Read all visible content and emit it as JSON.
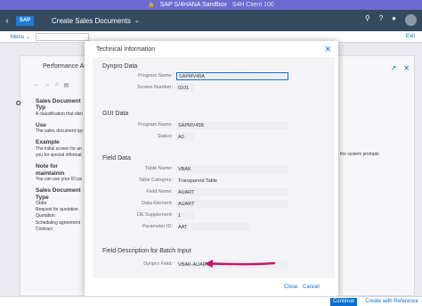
{
  "system_bar": {
    "title": "SAP S/4HANA Sandbox",
    "client": "S4H Client 100"
  },
  "shell": {
    "app_title": "Create Sales Documents",
    "logo": "SAP"
  },
  "menubar": {
    "menu": "Menu",
    "exit": "Exit"
  },
  "background": {
    "perf_title": "Performance As",
    "o_letter": "O",
    "help_lines": [
      {
        "t": "Sales Document Typ",
        "h": true
      },
      {
        "t": "A classification that disti",
        "h": false
      },
      {
        "t": "Use",
        "h": true
      },
      {
        "t": "The sales document typ",
        "h": false
      },
      {
        "t": "Example",
        "h": true
      },
      {
        "t": "The initial screen for an",
        "h": false
      },
      {
        "t": "you for special informat",
        "h": false
      },
      {
        "t": "Note for maintainin",
        "h": true
      },
      {
        "t": "You can use your ID pa",
        "h": false
      },
      {
        "t": "Sales Document Type",
        "h": true
      },
      {
        "t": "Order",
        "h": false
      },
      {
        "t": "Request for quotation",
        "h": false
      },
      {
        "t": "Quotation",
        "h": false
      },
      {
        "t": "Scheduling agreement",
        "h": false
      },
      {
        "t": "Contract",
        "h": false
      }
    ],
    "right_text": "the system prompts"
  },
  "dialog": {
    "title": "Technical Information",
    "sections": {
      "dynpro": {
        "heading": "Dynpro Data",
        "program_name_label": "Program Name:",
        "program_name": "SAPMV45A",
        "screen_number_label": "Screen Number:",
        "screen_number": "0101"
      },
      "gui": {
        "heading": "GUI Data",
        "program_name_label": "Program Name:",
        "program_name": "SAPMV45B",
        "status_label": "Status:",
        "status": "A0"
      },
      "field": {
        "heading": "Field Data",
        "table_name_label": "Table Name:",
        "table_name": "VBAK",
        "table_category_label": "Table Category:",
        "table_category": "Transparent Table",
        "field_name_label": "Field Name:",
        "field_name": "AUART",
        "data_element_label": "Data Element:",
        "data_element": "AUART",
        "de_supplement_label": "DE Supplement:",
        "de_supplement": "1",
        "parameter_id_label": "Parameter ID:",
        "parameter_id": "AAT"
      },
      "batch": {
        "heading": "Field Description for Batch Input",
        "dynpro_field_label": "Dynpro Field:",
        "dynpro_field": "VBAK-AUART"
      }
    },
    "close_label": "Close",
    "cancel_label": "Cancel"
  },
  "footer": {
    "continue": "Continue",
    "create_with_reference": "Create with Reference"
  },
  "colors": {
    "shell": "#354a5f",
    "accent": "#0a6ed1",
    "arrow": "#c4156b",
    "system_bar": "#6d6ad0"
  }
}
